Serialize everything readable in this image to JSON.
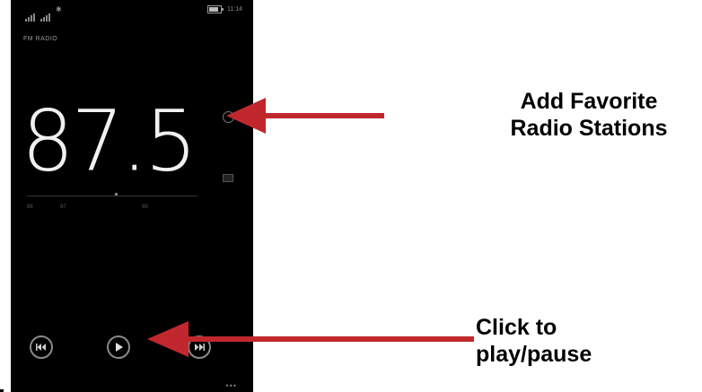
{
  "status_bar": {
    "time": "11:14",
    "battery_level": 0.8,
    "icons": [
      "signal-icon",
      "signal-icon",
      "bluetooth-icon",
      "battery-icon"
    ]
  },
  "app": {
    "title": "FM RADIO",
    "frequency": "87.5",
    "tuner_ticks": [
      "88",
      "87",
      "88"
    ],
    "menu": "•••"
  },
  "controls": {
    "previous_icon": "skip-back-icon",
    "play_icon": "play-icon",
    "next_icon": "skip-forward-icon"
  },
  "annotations": {
    "favorite_line1": "Add Favorite",
    "favorite_line2": "Radio Stations",
    "play_line1": "Click to",
    "play_line2": "play/pause",
    "arrow_color": "#c0282d"
  }
}
